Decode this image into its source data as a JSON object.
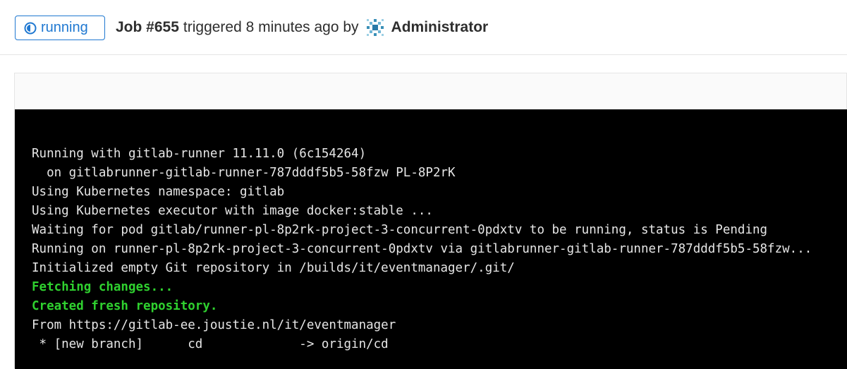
{
  "header": {
    "status_label": "running",
    "job_label": "Job #655",
    "triggered_text": "triggered 8 minutes ago by",
    "user_name": "Administrator",
    "status_color": "#1f78d1"
  },
  "log": {
    "lines": [
      {
        "text": "Running with gitlab-runner 11.11.0 (6c154264)",
        "style": "normal"
      },
      {
        "text": "  on gitlabrunner-gitlab-runner-787dddf5b5-58fzw PL-8P2rK",
        "style": "normal"
      },
      {
        "text": "Using Kubernetes namespace: gitlab",
        "style": "normal"
      },
      {
        "text": "Using Kubernetes executor with image docker:stable ...",
        "style": "normal"
      },
      {
        "text": "Waiting for pod gitlab/runner-pl-8p2rk-project-3-concurrent-0pdxtv to be running, status is Pending",
        "style": "normal"
      },
      {
        "text": "Running on runner-pl-8p2rk-project-3-concurrent-0pdxtv via gitlabrunner-gitlab-runner-787dddf5b5-58fzw...",
        "style": "normal"
      },
      {
        "text": "Initialized empty Git repository in /builds/it/eventmanager/.git/",
        "style": "normal"
      },
      {
        "text": "Fetching changes...",
        "style": "green"
      },
      {
        "text": "Created fresh repository.",
        "style": "green"
      },
      {
        "text": "From https://gitlab-ee.joustie.nl/it/eventmanager",
        "style": "normal"
      },
      {
        "text": " * [new branch]      cd             -> origin/cd",
        "style": "normal"
      }
    ]
  }
}
